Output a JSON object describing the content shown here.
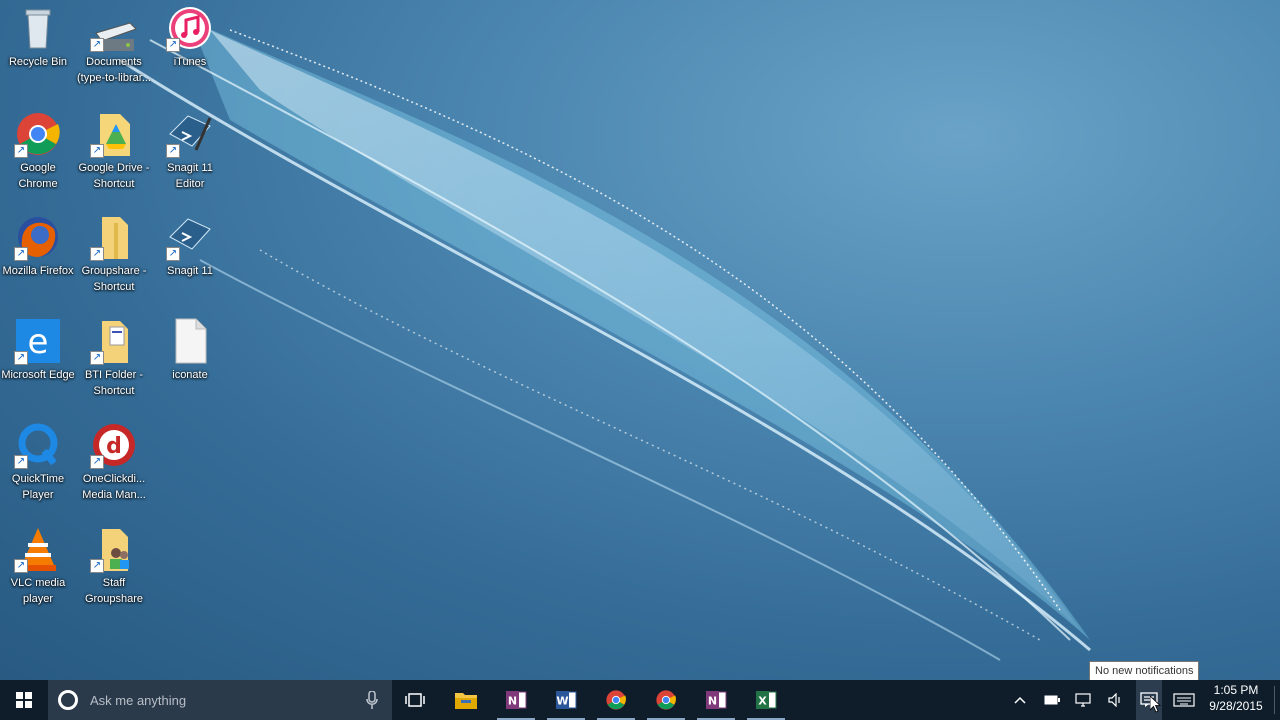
{
  "desktop": {
    "icons": [
      {
        "label": "Recycle Bin",
        "icon": "recycle-bin-icon"
      },
      {
        "label": "Documents (type-to-librar...",
        "icon": "drive-icon"
      },
      {
        "label": "iTunes",
        "icon": "itunes-icon"
      },
      {
        "label": "Google Chrome",
        "icon": "chrome-icon"
      },
      {
        "label": "Google Drive - Shortcut",
        "icon": "google-drive-folder-icon"
      },
      {
        "label": "Snagit 11 Editor",
        "icon": "snagit-editor-icon"
      },
      {
        "label": "Mozilla Firefox",
        "icon": "firefox-icon"
      },
      {
        "label": "Groupshare - Shortcut",
        "icon": "folder-icon"
      },
      {
        "label": "Snagit 11",
        "icon": "snagit-icon"
      },
      {
        "label": "Microsoft Edge",
        "icon": "edge-icon"
      },
      {
        "label": "BTI Folder - Shortcut",
        "icon": "folder-doc-icon"
      },
      {
        "label": "iconate",
        "icon": "blank-file-icon"
      },
      {
        "label": "QuickTime Player",
        "icon": "quicktime-icon"
      },
      {
        "label": "OneClickdi... Media Man...",
        "icon": "oneclick-icon"
      },
      {
        "label": "VLC media player",
        "icon": "vlc-icon"
      },
      {
        "label": "Staff Groupshare",
        "icon": "folder-users-icon"
      }
    ]
  },
  "tooltip": {
    "text": "No new notifications"
  },
  "taskbar": {
    "search_placeholder": "Ask me anything",
    "apps": [
      {
        "name": "task-view",
        "icon": "task-view-icon"
      },
      {
        "name": "file-explorer",
        "icon": "file-explorer-icon"
      },
      {
        "name": "onenote",
        "icon": "onenote-icon",
        "color": "#80397b"
      },
      {
        "name": "word",
        "icon": "word-icon",
        "color": "#2b579a"
      },
      {
        "name": "chrome",
        "icon": "chrome-icon"
      },
      {
        "name": "chrome-2",
        "icon": "chrome-icon"
      },
      {
        "name": "onenote-2",
        "icon": "onenote-icon",
        "color": "#80397b"
      },
      {
        "name": "excel",
        "icon": "excel-icon",
        "color": "#217346"
      }
    ],
    "clock": {
      "time": "1:05 PM",
      "date": "9/28/2015"
    }
  },
  "colors": {
    "taskbar": "#0f1d2b",
    "search": "#2b3a4a",
    "desktop": "#3b79a5"
  }
}
